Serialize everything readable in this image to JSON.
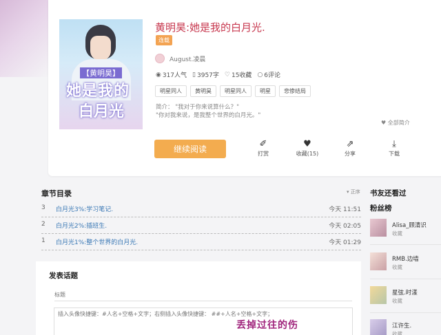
{
  "book": {
    "title": "黄明昊:她是我的白月光.",
    "status_badge": "连载",
    "author": "August.凌晨",
    "stats": {
      "popularity": "317人气",
      "words": "3957字",
      "favorites": "15收藏",
      "comments": "6评论"
    },
    "tags": [
      "明星同人",
      "黄明昊",
      "明星同人",
      "明星",
      "悲惨结局"
    ],
    "intro_line1": "简介：  \"我对于你来说算什么？\"",
    "intro_line2": "\"你对我来说，是我整个世界的白月光。\"",
    "more_intro": "全部简介",
    "cover": {
      "line1": "【黄明昊】",
      "line2": "她是我的",
      "line3": "白月光"
    }
  },
  "actions": {
    "read_label": "继续阅读",
    "reward_label": "打赏",
    "collect_label": "收藏(15)",
    "share_label": "分享",
    "download_label": "下载"
  },
  "chapters": {
    "heading": "章节目录",
    "sort_label": "正序",
    "items": [
      {
        "num": "3",
        "title": "白月光3%:学习笔记.",
        "time": "今天 11:51"
      },
      {
        "num": "2",
        "title": "白月光2%:插班生.",
        "time": "今天 02:05"
      },
      {
        "num": "1",
        "title": "白月光1%:整个世界的白月光.",
        "time": "今天 01:29"
      }
    ]
  },
  "sidebar": {
    "also_read_heading": "书友还看过",
    "fans_heading": "粉丝榜",
    "fans": [
      {
        "name": "Alisa_顾清识",
        "role": "收藏"
      },
      {
        "name": "RMB.边墙",
        "role": "收藏"
      },
      {
        "name": "星弦.时漾",
        "role": "收藏"
      },
      {
        "name": "江许生.",
        "role": "收藏"
      }
    ]
  },
  "post": {
    "heading": "发表话题",
    "title_placeholder": "标题",
    "body_placeholder": "插入头像快捷键：#人名+空格+文字；右侧插入头像快捷键： ##+人名+空格+文字；",
    "watermark": "丢掉过往的伤"
  },
  "colors": {
    "accent": "#f3ac4f",
    "title_red": "#c7374e",
    "link_blue": "#3a78b5"
  }
}
